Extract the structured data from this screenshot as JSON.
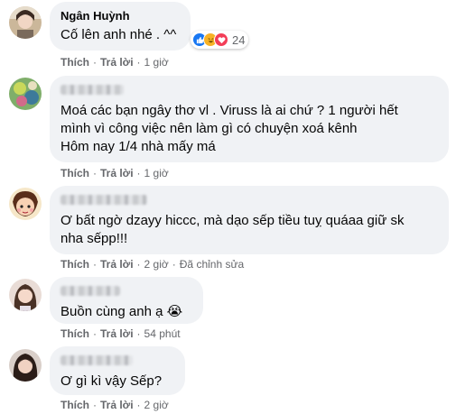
{
  "colors": {
    "bubble": "#f0f2f5",
    "meta": "#65676b",
    "like": "#1877f2",
    "haha": "#f7b125",
    "love": "#f33e58"
  },
  "comments": [
    {
      "author": "Ngân Huỳnh",
      "text": "Cố lên anh nhé . ^^",
      "like_label": "Thích",
      "reply_label": "Trả lời",
      "time": "1 giờ",
      "reactions": {
        "icons": [
          "like-icon",
          "haha-icon",
          "love-icon"
        ],
        "count": "24"
      }
    },
    {
      "author": "",
      "text": "Moá các bạn ngây thơ vl . Viruss là ai chứ ? 1 người hết\nmình vì công việc nên làm gì có chuyện xoá kênh\nHôm nay 1/4 nhà mấy má",
      "like_label": "Thích",
      "reply_label": "Trả lời",
      "time": "1 giờ"
    },
    {
      "author": "",
      "text": "Ơ bất ngờ dzayy hiccc, mà dạo sếp tiều tuỵ quáaa giữ sk\nnha sếpp!!!",
      "like_label": "Thích",
      "reply_label": "Trả lời",
      "time": "2 giờ",
      "edited": "Đã chỉnh sửa"
    },
    {
      "author": "",
      "text": "Buồn cùng anh ạ",
      "emoji": "😭",
      "like_label": "Thích",
      "reply_label": "Trả lời",
      "time": "54 phút"
    },
    {
      "author": "",
      "text": "Ơ gì kì vậy Sếp?",
      "like_label": "Thích",
      "reply_label": "Trả lời",
      "time": "2 giờ"
    }
  ]
}
